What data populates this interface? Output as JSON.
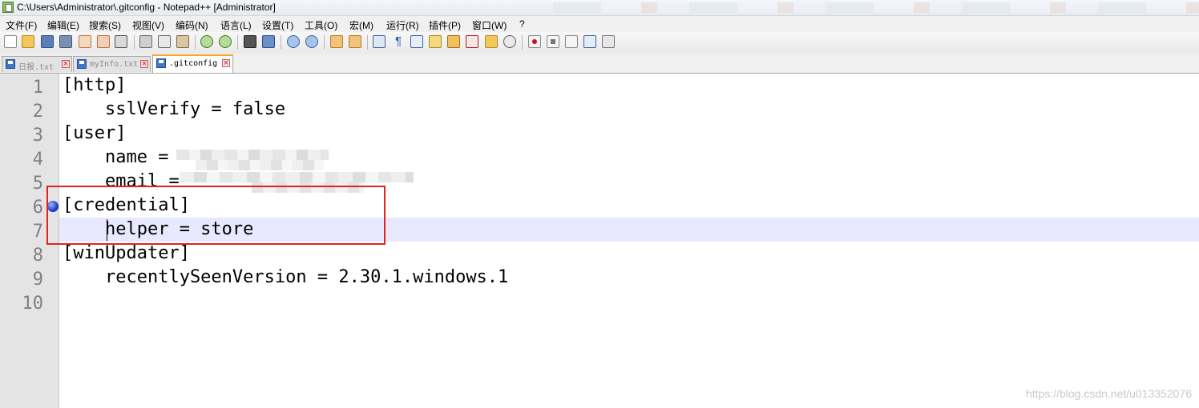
{
  "window": {
    "title": "C:\\Users\\Administrator\\.gitconfig - Notepad++ [Administrator]"
  },
  "menu": [
    "文件(F)",
    "编辑(E)",
    "搜索(S)",
    "视图(V)",
    "编码(N)",
    "语言(L)",
    "设置(T)",
    "工具(O)",
    "宏(M)",
    "运行(R)",
    "插件(P)",
    "窗口(W)",
    "?"
  ],
  "toolbar": {
    "icons": [
      "new-file-icon",
      "open-file-icon",
      "save-icon",
      "save-all-icon",
      "close-icon",
      "close-all-icon",
      "print-icon",
      "cut-icon",
      "copy-icon",
      "paste-icon",
      "undo-icon",
      "redo-icon",
      "find-icon",
      "replace-icon",
      "zoom-in-icon",
      "zoom-out-icon",
      "sync-vertical-icon",
      "sync-horizontal-icon",
      "word-wrap-icon",
      "show-all-chars-icon",
      "indent-guide-icon",
      "user-language-icon",
      "doc-map-icon",
      "function-list-icon",
      "folder-workspace-icon",
      "monitor-icon",
      "macro-record-icon",
      "macro-stop-icon",
      "macro-play-icon",
      "macro-run-multiple-icon",
      "macro-save-icon"
    ]
  },
  "tabs": [
    {
      "label": "日报.txt",
      "active": false
    },
    {
      "label": "myInfo.txt",
      "active": false
    },
    {
      "label": ".gitconfig",
      "active": true
    }
  ],
  "editor": {
    "current_line": 7,
    "bookmark_line": 6,
    "lines": [
      {
        "num": "1",
        "text": "[http]"
      },
      {
        "num": "2",
        "text": "    sslVerify = false"
      },
      {
        "num": "3",
        "text": "[user]"
      },
      {
        "num": "4",
        "text": "    name = "
      },
      {
        "num": "5",
        "text": "    email = "
      },
      {
        "num": "6",
        "text": "[credential]"
      },
      {
        "num": "7",
        "text": "    helper = store"
      },
      {
        "num": "8",
        "text": "[winUpdater]"
      },
      {
        "num": "9",
        "text": "    recentlySeenVersion = 2.30.1.windows.1"
      },
      {
        "num": "10",
        "text": ""
      }
    ]
  },
  "annotation": {
    "highlight_color": "#e0231c"
  },
  "watermark": "https://blog.csdn.net/u013352076"
}
